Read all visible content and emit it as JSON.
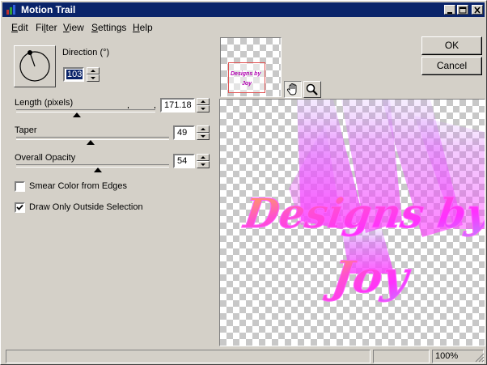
{
  "window": {
    "title": "Motion Trail"
  },
  "menu": {
    "items": [
      {
        "label": "Edit",
        "ul": "E",
        "rest": "dit"
      },
      {
        "label": "Filter",
        "pre": "Fi",
        "ul": "l",
        "rest": "ter"
      },
      {
        "label": "View",
        "ul": "V",
        "rest": "iew"
      },
      {
        "label": "Settings",
        "ul": "S",
        "rest": "ettings"
      },
      {
        "label": "Help",
        "ul": "H",
        "rest": "elp"
      }
    ]
  },
  "direction": {
    "label": "Direction (°)",
    "value": "103"
  },
  "length": {
    "label": "Length (pixels)",
    "value": "171.18"
  },
  "taper": {
    "label": "Taper",
    "value": "49"
  },
  "opacity": {
    "label": "Overall Opacity",
    "value": "54"
  },
  "options": {
    "smear_label": "Smear Color from Edges",
    "smear_checked": false,
    "draw_only_label": "Draw Only Outside Selection",
    "draw_only_checked": true
  },
  "buttons": {
    "ok": "OK",
    "cancel": "Cancel"
  },
  "preview": {
    "text_line1": "Designs by",
    "text_line2": "Joy",
    "thumb_line1": "Designs by",
    "thumb_line2": "Joy"
  },
  "status": {
    "zoom": "100%"
  },
  "colors": {
    "titlebar": "#0a246a",
    "face": "#d4d0c8",
    "text_gradient_start": "#ff40ff",
    "text_gradient_end": "#ffb040",
    "nav_box": "#e05050"
  },
  "icons": [
    "hand-icon",
    "zoom-icon",
    "minimize-icon",
    "maximize-icon",
    "close-icon",
    "app-icon"
  ]
}
